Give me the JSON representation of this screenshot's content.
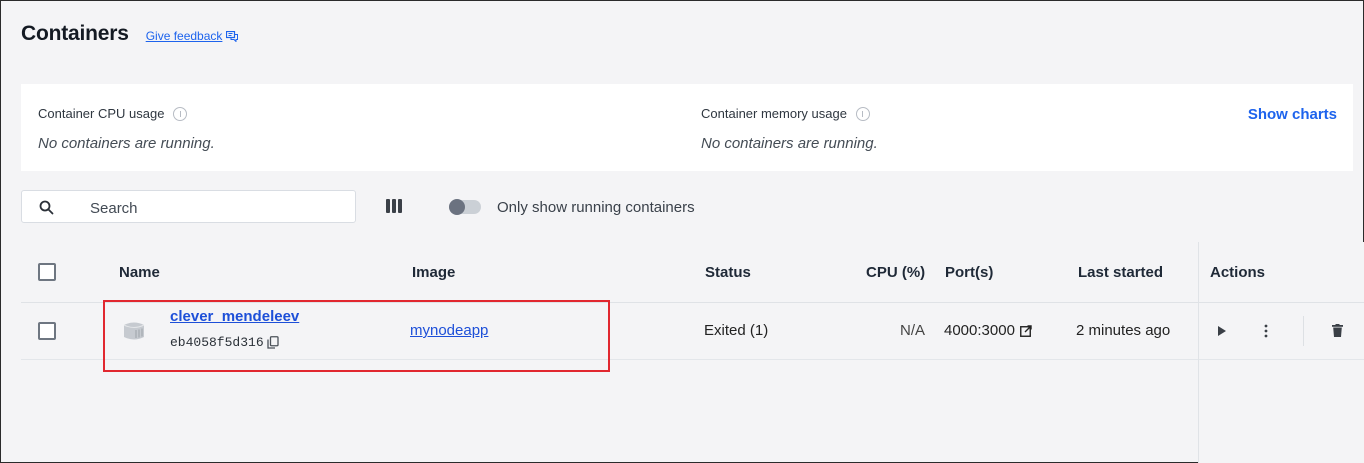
{
  "header": {
    "title": "Containers",
    "feedback_label": "Give feedback"
  },
  "usage": {
    "cpu_label": "Container CPU usage",
    "cpu_empty": "No containers are running.",
    "memory_label": "Container memory usage",
    "memory_empty": "No containers are running.",
    "show_charts_label": "Show charts"
  },
  "toolbar": {
    "search_placeholder": "Search",
    "toggle_label": "Only show running containers",
    "toggle_on": false
  },
  "table": {
    "columns": {
      "name": "Name",
      "image": "Image",
      "status": "Status",
      "cpu": "CPU (%)",
      "ports": "Port(s)",
      "last_started": "Last started",
      "actions": "Actions"
    },
    "rows": [
      {
        "name": "clever_mendeleev",
        "id": "eb4058f5d316",
        "image": "mynodeapp",
        "status": "Exited (1)",
        "cpu": "N/A",
        "ports": "4000:3000",
        "last_started": "2 minutes ago"
      }
    ]
  },
  "icons": {
    "feedback": "feedback-icon",
    "info": "info-icon",
    "search": "search-icon",
    "columns": "columns-icon",
    "container": "container-icon",
    "copy": "copy-icon",
    "external_link": "external-link-icon",
    "play": "play-icon",
    "more": "more-vertical-icon",
    "delete": "trash-icon"
  },
  "colors": {
    "accent": "#1d63ed",
    "highlight_box": "#e1272f",
    "background": "#f4f4f6"
  }
}
